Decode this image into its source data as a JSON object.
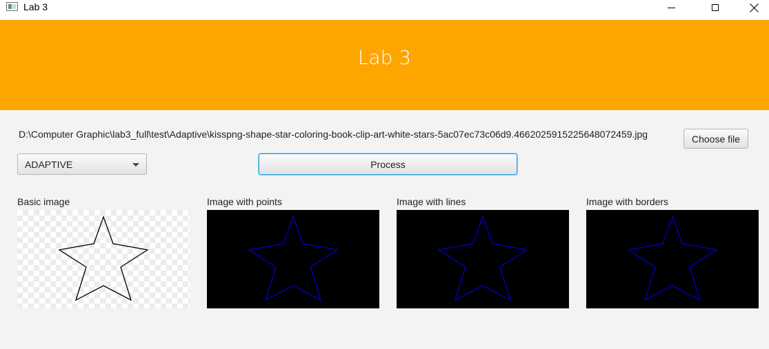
{
  "window": {
    "title": "Lab 3",
    "icon": "app-window-icon",
    "controls": [
      "minimize-icon",
      "maximize-icon",
      "close-icon"
    ]
  },
  "header": {
    "title": "Lab 3",
    "background_color": "#ffa500"
  },
  "file": {
    "path": "D:\\Computer Graphic\\lab3_full\\test\\Adaptive\\kisspng-shape-star-coloring-book-clip-art-white-stars-5ac07ec73c06d9.4662025915225648072459.jpg",
    "choose_label": "Choose file"
  },
  "controls": {
    "mode_selected": "ADAPTIVE",
    "process_label": "Process"
  },
  "panels": [
    {
      "label": "Basic image",
      "background": "checker",
      "stroke_color": "#000000"
    },
    {
      "label": "Image with points",
      "background": "#000000",
      "stroke_color": "#0000cc"
    },
    {
      "label": "Image with lines",
      "background": "#000000",
      "stroke_color": "#0000cc"
    },
    {
      "label": "Image with borders",
      "background": "#000000",
      "stroke_color": "#0000cc"
    }
  ]
}
